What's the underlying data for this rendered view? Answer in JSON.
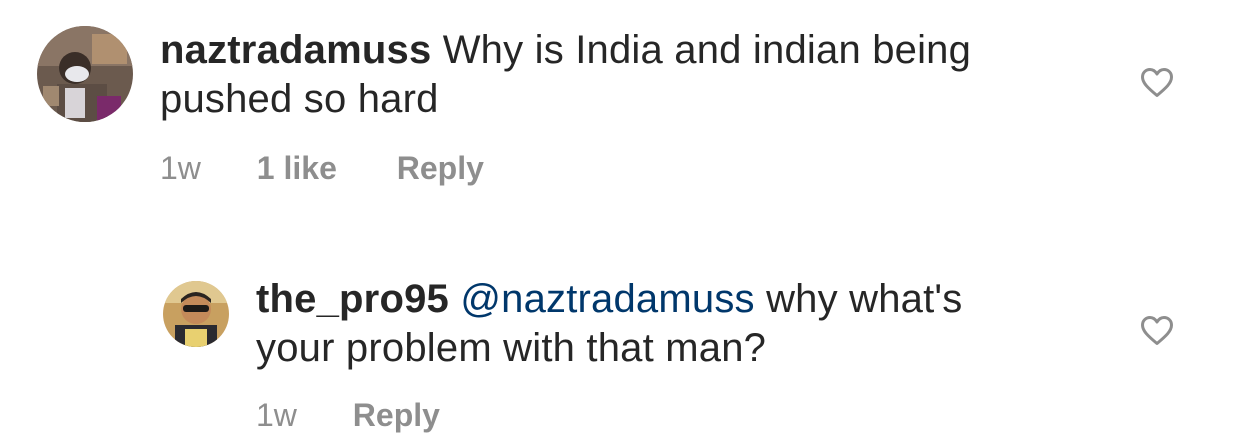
{
  "comments": [
    {
      "username": "naztradamuss",
      "text_line1": "Why is India and indian being",
      "text_line2": "pushed so hard",
      "time": "1w",
      "likes": "1 like",
      "reply": "Reply",
      "icon": "heart-outline-icon"
    },
    {
      "username": "the_pro95",
      "mention": "@naztradamuss",
      "text_line1": "why what's",
      "text_line2": "your problem with that man?",
      "time": "1w",
      "reply": "Reply",
      "icon": "heart-outline-icon"
    }
  ],
  "colors": {
    "text": "#262626",
    "meta": "#8e8e8e",
    "mention": "#00376b"
  }
}
